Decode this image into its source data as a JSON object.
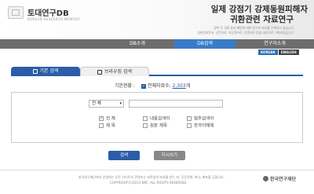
{
  "header": {
    "logo_text": "토대연구DB",
    "logo_sub": "KOREAN RESEARCH MEMORY",
    "title_line1": "일제 강점기 강제동원피해자",
    "title_line2": "귀환관련 자료연구",
    "desc_line1": "광복 후 귀환 동포 패턴에 대한 연구와 자료를 수록하고 있습니다",
    "desc_line2": "일본정부문서, 신문자료, 미군정자료, 인명자료 등을 대상으로 구축되었습니다"
  },
  "nav": {
    "items": [
      "DB소개",
      "DB검색",
      "",
      "연구자소개"
    ]
  },
  "lang": {
    "korean": "KOREAN",
    "english": "ENGLISH"
  },
  "tabs": {
    "basic": "기본 검색",
    "browse": "브라우징 검색"
  },
  "status": {
    "label": "기본현황 :",
    "total_label": "전체자료수:",
    "count": "2,303",
    "unit": "개"
  },
  "search": {
    "select_value": "전 체",
    "input_value": ""
  },
  "checkboxes": [
    {
      "label": "전 체",
      "checked": true
    },
    {
      "label": "내용검색어",
      "checked": false
    },
    {
      "label": "범주검색어",
      "checked": false
    },
    {
      "label": "제 목",
      "checked": false
    },
    {
      "label": "원문 제목",
      "checked": false
    },
    {
      "label": "한국어해제",
      "checked": false
    }
  ],
  "buttons": {
    "search": "검색",
    "reset": "다시쓰기"
  },
  "footer": {
    "line1": "한국연구재단에서 운영하는 모든 사이트의 콘텐츠는 저작권의 보호를 받는 바, 무단전재, 복사, 배포를 금합니다.",
    "line2": "COPYRIGHT(C)2013 NRF, ALL RIGHTS RESERVED.",
    "logo": "한국연구재단"
  }
}
